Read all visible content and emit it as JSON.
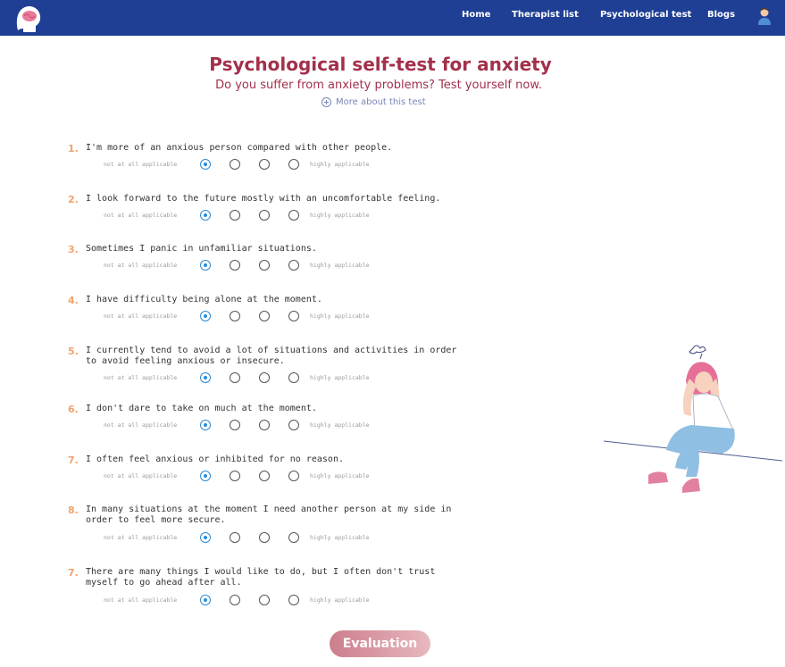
{
  "nav": {
    "links": [
      "Home",
      "Therapist list",
      "Psychological test",
      "Blogs"
    ]
  },
  "header": {
    "title": "Psychological self-test for anxiety",
    "subtitle": "Do you suffer from anxiety problems? Test yourself now.",
    "more_link": "More about this test"
  },
  "scale": {
    "low": "not at all applicable",
    "high": "highly applicable"
  },
  "questions": [
    {
      "num": "1.",
      "text": "I'm more of an anxious person compared with other people.",
      "selected": 1
    },
    {
      "num": "2.",
      "text": "I look forward to the future mostly with an uncomfortable feeling.",
      "selected": 1
    },
    {
      "num": "3.",
      "text": "Sometimes I panic in unfamiliar situations.",
      "selected": 1
    },
    {
      "num": "4.",
      "text": "I have difficulty being alone at the moment.",
      "selected": 1
    },
    {
      "num": "5.",
      "text": "I currently tend to avoid a lot of situations and activities in order\nto avoid feeling anxious or insecure.",
      "selected": 1
    },
    {
      "num": "6.",
      "text": "I don't dare to take on much at the moment.",
      "selected": 1
    },
    {
      "num": "7.",
      "text": "I often feel anxious or inhibited for no reason.",
      "selected": 1
    },
    {
      "num": "8.",
      "text": "In many situations at the moment I need another person at my side in\norder to feel more secure.",
      "selected": 1
    },
    {
      "num": "7.",
      "text": "There are many things I would like to do, but I often don't trust\nmyself to go ahead after all.",
      "selected": 1
    }
  ],
  "buttons": {
    "evaluation": "Evaluation"
  },
  "colors": {
    "navbar": "#1f3f94",
    "title": "#a3304a",
    "number": "#f0a36e",
    "radio_selected": "#2b8bd6"
  },
  "icons": {
    "logo": "head-brain-icon",
    "avatar": "user-avatar-icon",
    "more": "plus-circle-icon"
  }
}
